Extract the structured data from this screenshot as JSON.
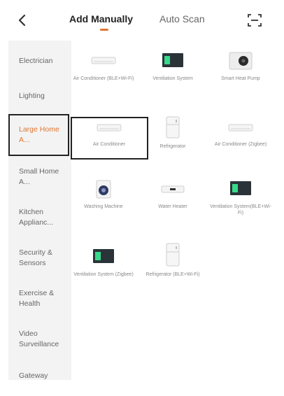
{
  "header": {
    "tabs": [
      {
        "label": "Add Manually",
        "active": true
      },
      {
        "label": "Auto Scan",
        "active": false
      }
    ],
    "accent_color": "#e0762f"
  },
  "sidebar": {
    "items": [
      {
        "label": "Electrician"
      },
      {
        "label": "Lighting"
      },
      {
        "label": "Large Home A...",
        "active": true
      },
      {
        "label": "Small Home A..."
      },
      {
        "label": "Kitchen Applianc..."
      },
      {
        "label": "Security & Sensors"
      },
      {
        "label": "Exercise & Health"
      },
      {
        "label": "Video Surveillance"
      },
      {
        "label": "Gateway"
      }
    ]
  },
  "devices": [
    {
      "label": "Air Conditioner (BLE+Wi-Fi)",
      "icon": "air-conditioner-icon"
    },
    {
      "label": "Ventilation System",
      "icon": "ventilation-unit-icon"
    },
    {
      "label": "Smart Heat Pump",
      "icon": "heat-pump-icon"
    },
    {
      "label": "Air Conditioner",
      "icon": "air-conditioner-icon",
      "selected": true
    },
    {
      "label": "Refrigerator",
      "icon": "refrigerator-icon"
    },
    {
      "label": "Air Conditioner (Zigbee)",
      "icon": "air-conditioner-icon"
    },
    {
      "label": "Washing Machine",
      "icon": "washing-machine-icon"
    },
    {
      "label": "Water Heater",
      "icon": "water-heater-icon"
    },
    {
      "label": "Ventilation System(BLE+Wi-Fi)",
      "icon": "ventilation-unit-icon"
    },
    {
      "label": "Ventilation System (Zigbee)",
      "icon": "ventilation-unit-icon"
    },
    {
      "label": "Refrigerator (BLE+Wi-Fi)",
      "icon": "refrigerator-icon"
    }
  ]
}
